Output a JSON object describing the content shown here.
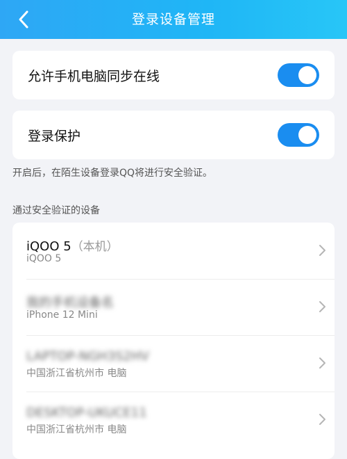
{
  "header": {
    "title": "登录设备管理",
    "back_icon": "chevron-left-icon"
  },
  "settings": {
    "sync_online_label": "允许手机电脑同步在线",
    "sync_online_enabled": true,
    "login_protection_label": "登录保护",
    "login_protection_enabled": true,
    "hint": "开启后，在陌生设备登录QQ将进行安全验证。"
  },
  "devices_section": {
    "label": "通过安全验证的设备",
    "devices": [
      {
        "name": "iQOO 5",
        "local_tag": "（本机）",
        "sub": "iQOO 5"
      },
      {
        "name": "我的手机设备名",
        "sub": "iPhone 12 Mini"
      },
      {
        "name": "LAPTOP-NGH3S2HV",
        "sub": "中国浙江省杭州市 电脑"
      },
      {
        "name": "DESKTOP-UKUCE11",
        "sub": "中国浙江省杭州市 电脑"
      }
    ]
  },
  "colors": {
    "header_start": "#2ea7f5",
    "header_end": "#28c6f7",
    "toggle_on": "#1a8df0",
    "background": "#f2f3f7"
  }
}
